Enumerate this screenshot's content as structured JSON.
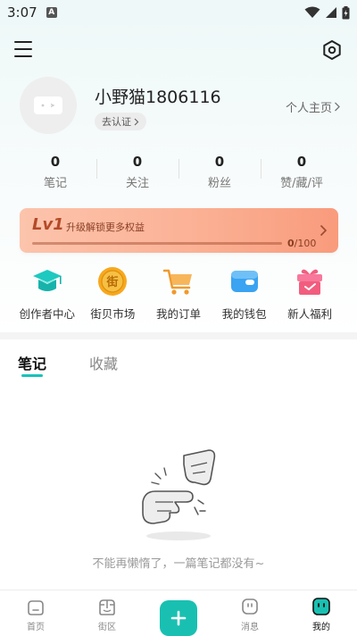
{
  "status_bar": {
    "time": "3:07",
    "notification_badge": "A"
  },
  "profile": {
    "username": "小野猫1806116",
    "verify_label": "去认证",
    "homepage_label": "个人主页"
  },
  "stats": [
    {
      "count": "0",
      "label": "笔记"
    },
    {
      "count": "0",
      "label": "关注"
    },
    {
      "count": "0",
      "label": "粉丝"
    },
    {
      "count": "0",
      "label": "赞/藏/评"
    }
  ],
  "level": {
    "title": "Lv1",
    "subtitle": "升级解锁更多权益",
    "current": "0",
    "total": "/100",
    "progress_fraction": 0
  },
  "shortcuts": [
    {
      "label": "创作者中心",
      "icon": "graduation-cap-icon",
      "color": "#1ec9c0"
    },
    {
      "label": "街贝市场",
      "icon": "coin-icon",
      "color": "#f5a21b"
    },
    {
      "label": "我的订单",
      "icon": "shopping-cart-icon",
      "color": "#f7a234"
    },
    {
      "label": "我的钱包",
      "icon": "wallet-icon",
      "color": "#3aa3f2"
    },
    {
      "label": "新人福利",
      "icon": "gift-icon",
      "color": "#f25d7e"
    }
  ],
  "tabs": {
    "notes": "笔记",
    "favorites": "收藏"
  },
  "empty_state": {
    "text": "不能再懒惰了，一篇笔记都没有~"
  },
  "bottom_nav": {
    "home": "首页",
    "street": "街区",
    "messages": "消息",
    "me": "我的"
  },
  "colors": {
    "accent": "#18c2bb",
    "level_card": "#fbb195"
  }
}
